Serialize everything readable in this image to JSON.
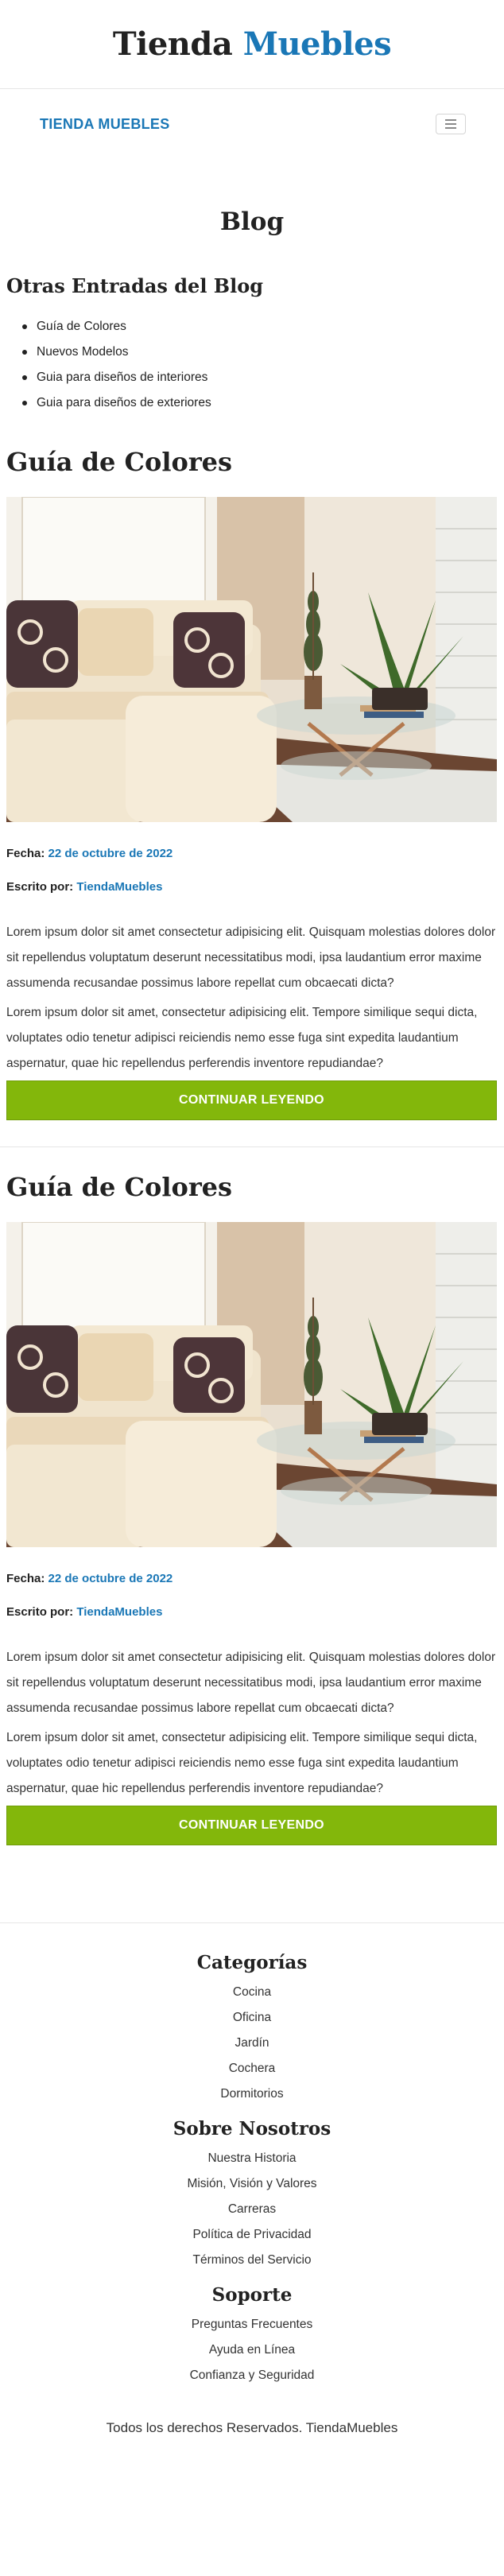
{
  "header": {
    "brand_part1": "Tienda",
    "brand_part2": "Muebles"
  },
  "navbar": {
    "brand": "TIENDA MUEBLES",
    "toggle_icon": "hamburger-icon"
  },
  "page": {
    "title": "Blog"
  },
  "sidebar": {
    "title": "Otras Entradas del Blog",
    "items": [
      "Guía de Colores",
      "Nuevos Modelos",
      "Guia para diseños de interiores",
      "Guia para diseños de exteriores"
    ]
  },
  "entries": [
    {
      "title": "Guía de Colores",
      "date_label": "Fecha:",
      "date": "22 de octubre de 2022",
      "author_label": "Escrito por:",
      "author": "TiendaMuebles",
      "p1": "Lorem ipsum dolor sit amet consectetur adipisicing elit. Quisquam molestias dolores dolor sit repellendus voluptatum deserunt necessitatibus modi, ipsa laudantium error maxime assumenda recusandae possimus labore repellat cum obcaecati dicta?",
      "p2": "Lorem ipsum dolor sit amet, consectetur adipisicing elit. Tempore similique sequi dicta, voluptates odio tenetur adipisci reiciendis nemo esse fuga sint expedita laudantium aspernatur, quae hic repellendus perferendis inventore repudiandae?",
      "button": "CONTINUAR LEYENDO"
    },
    {
      "title": "Guía de Colores",
      "date_label": "Fecha:",
      "date": "22 de octubre de 2022",
      "author_label": "Escrito por:",
      "author": "TiendaMuebles",
      "p1": "Lorem ipsum dolor sit amet consectetur adipisicing elit. Quisquam molestias dolores dolor sit repellendus voluptatum deserunt necessitatibus modi, ipsa laudantium error maxime assumenda recusandae possimus labore repellat cum obcaecati dicta?",
      "p2": "Lorem ipsum dolor sit amet, consectetur adipisicing elit. Tempore similique sequi dicta, voluptates odio tenetur adipisci reiciendis nemo esse fuga sint expedita laudantium aspernatur, quae hic repellendus perferendis inventore repudiandae?",
      "button": "CONTINUAR LEYENDO"
    }
  ],
  "footer": {
    "categories": {
      "title": "Categorías",
      "items": [
        "Cocina",
        "Oficina",
        "Jardín",
        "Cochera",
        "Dormitorios"
      ]
    },
    "about": {
      "title": "Sobre Nosotros",
      "items": [
        "Nuestra Historia",
        "Misión, Visión y Valores",
        "Carreras",
        "Política de Privacidad",
        "Términos del Servicio"
      ]
    },
    "support": {
      "title": "Soporte",
      "items": [
        "Preguntas Frecuentes",
        "Ayuda en Línea",
        "Confianza y Seguridad"
      ]
    },
    "copyright": "Todos los derechos Reservados. TiendaMuebles"
  },
  "colors": {
    "brand_blue": "#1a77b6",
    "button_green": "#83b70b"
  }
}
